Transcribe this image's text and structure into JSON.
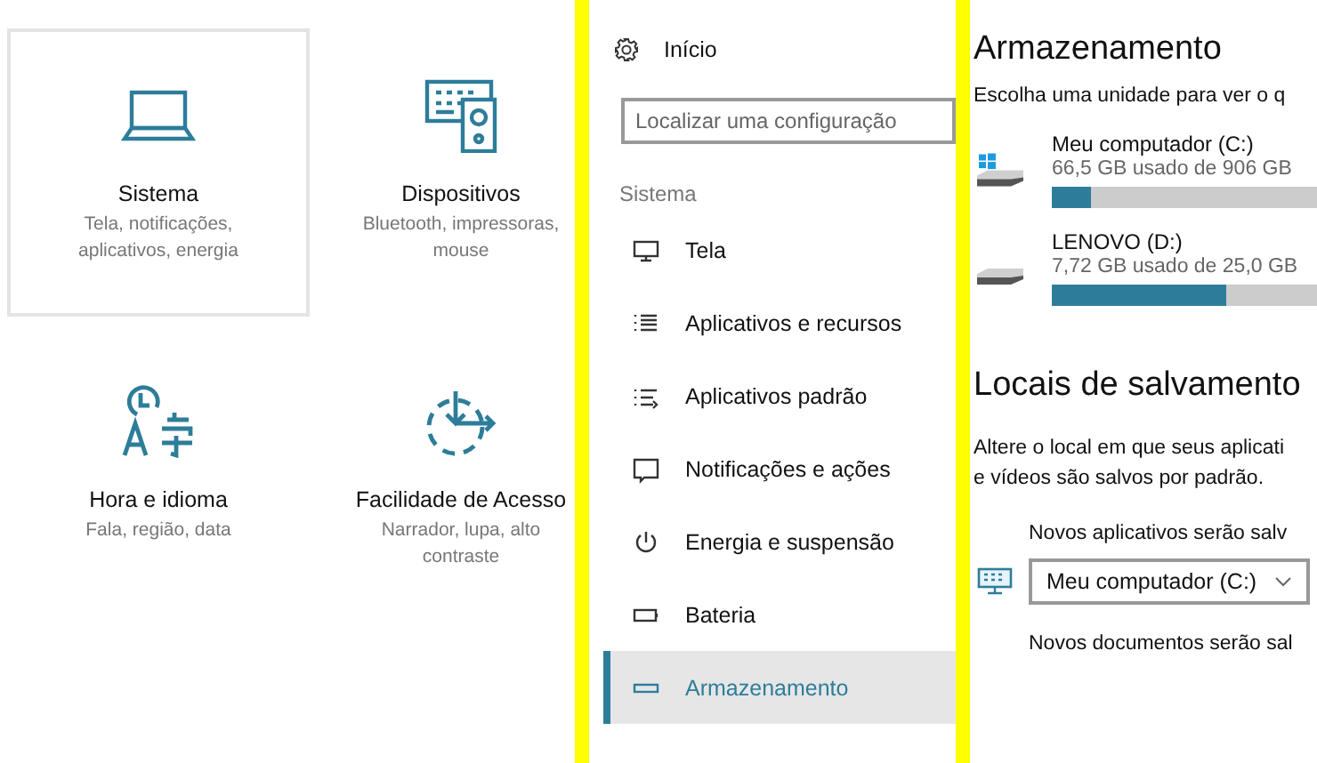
{
  "categories": [
    {
      "kind": "laptop",
      "title": "Sistema",
      "subtitle": "Tela, notificações, aplicativos, energia",
      "selected": true
    },
    {
      "kind": "devices",
      "title": "Dispositivos",
      "subtitle": "Bluetooth, impressoras, mouse",
      "selected": false
    },
    {
      "kind": "time-language",
      "title": "Hora e idioma",
      "subtitle": "Fala, região, data",
      "selected": false
    },
    {
      "kind": "ease-of-access",
      "title": "Facilidade de Acesso",
      "subtitle": "Narrador, lupa, alto contraste",
      "selected": false
    }
  ],
  "nav": {
    "home": "Início",
    "search": {
      "placeholder": "Localizar uma configuração"
    },
    "section": "Sistema",
    "items": [
      {
        "kind": "display",
        "label": "Tela",
        "selected": false
      },
      {
        "kind": "list",
        "label": "Aplicativos e recursos",
        "selected": false
      },
      {
        "kind": "defaults",
        "label": "Aplicativos padrão",
        "selected": false
      },
      {
        "kind": "notifications",
        "label": "Notificações e ações",
        "selected": false
      },
      {
        "kind": "power",
        "label": "Energia e suspensão",
        "selected": false
      },
      {
        "kind": "battery",
        "label": "Bateria",
        "selected": false
      },
      {
        "kind": "storage",
        "label": "Armazenamento",
        "selected": true
      }
    ]
  },
  "storage": {
    "title": "Armazenamento",
    "description": "Escolha uma unidade para ver o q",
    "drives": [
      {
        "kind": "system",
        "name": "Meu computador (C:)",
        "usage": "66,5 GB usado de 906 GB",
        "level": 0.15
      },
      {
        "kind": "removable",
        "name": "LENOVO (D:)",
        "usage": "7,72 GB usado de 25,0 GB",
        "level": 0.66
      }
    ]
  },
  "save_locations": {
    "title": "Locais de salvamento",
    "description": [
      "Altere o local em que seus aplicati",
      "e vídeos são salvos por padrão."
    ],
    "settings": [
      {
        "label": "Novos aplicativos serão salv",
        "value": "Meu computador (C:)"
      },
      {
        "label": "Novos documentos serão sal"
      }
    ]
  }
}
